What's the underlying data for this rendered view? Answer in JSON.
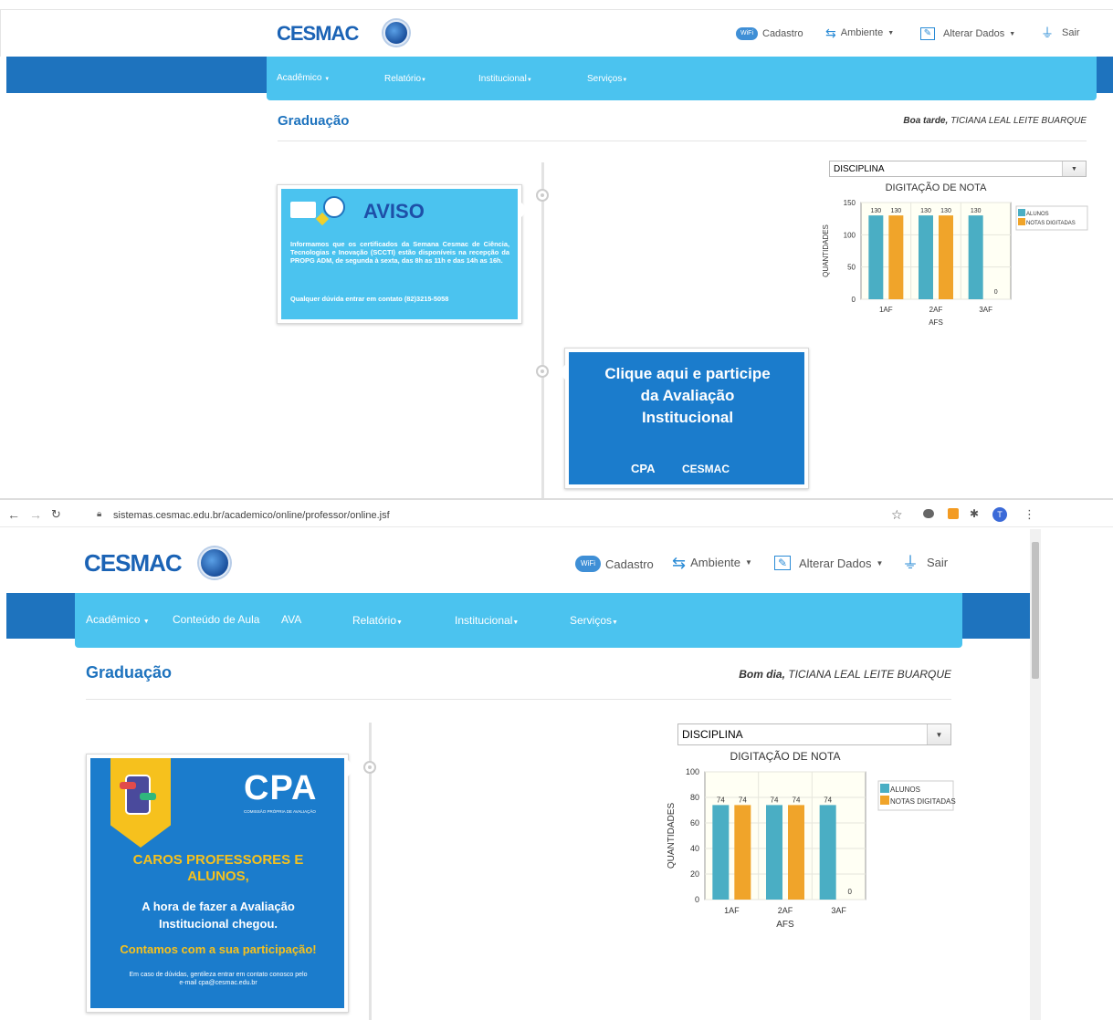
{
  "top": {
    "logo": "CESMAC",
    "nav": {
      "cadastro": "Cadastro",
      "ambiente": "Ambiente",
      "alterar": "Alterar Dados",
      "sair": "Sair",
      "wifi_text": "WiFi"
    },
    "menu": {
      "academico": "Acadêmico",
      "relatorio": "Relatório",
      "institucional": "Institucional",
      "servicos": "Serviços"
    },
    "page_title": "Graduação",
    "greeting_prefix": "Boa tarde,",
    "greeting_name": "TICIANA LEAL LEITE BUARQUE",
    "aviso": {
      "heading": "AVISO",
      "body": "Informamos que os certificados da Semana Cesmac de Ciência, Tecnologias e Inovação (SCCTI) estão disponíveis na recepção da PROPG ADM, de segunda à sexta, das 8h as 11h e das 14h as 16h.",
      "contact": "Qualquer dúvida entrar em contato (82)3215-5058"
    },
    "avaliacao": {
      "text": "Clique aqui e participe da Avaliação Institucional",
      "logo1": "CPA",
      "logo2": "CESMAC"
    },
    "select_value": "DISCIPLINA"
  },
  "browser": {
    "url": "sistemas.cesmac.edu.br/academico/online/professor/online.jsf",
    "profile_initial": "T"
  },
  "bottom": {
    "logo": "CESMAC",
    "nav": {
      "cadastro": "Cadastro",
      "ambiente": "Ambiente",
      "alterar": "Alterar Dados",
      "sair": "Sair",
      "wifi_text": "WiFi"
    },
    "menu": {
      "academico": "Acadêmico",
      "conteudo": "Conteúdo de Aula",
      "ava": "AVA",
      "relatorio": "Relatório",
      "institucional": "Institucional",
      "servicos": "Serviços"
    },
    "page_title": "Graduação",
    "greeting_prefix": "Bom dia,",
    "greeting_name": "TICIANA LEAL LEITE BUARQUE",
    "cpa_card": {
      "logo": "CPA",
      "logo_sub": "COMISSÃO PRÓPRIA DE AVALIAÇÃO",
      "heading": "CAROS PROFESSORES E ALUNOS,",
      "line1": "A hora de fazer a Avaliação Institucional chegou.",
      "line2": "Contamos com a sua participação!",
      "footer": "Em caso de dúvidas, gentileza entrar em contato conosco pelo e-mail cpa@cesmac.edu.br"
    },
    "select_value": "DISCIPLINA"
  },
  "chart_data": [
    {
      "type": "bar",
      "title": "DIGITAÇÃO DE NOTA",
      "xlabel": "AFS",
      "ylabel": "QUANTIDADES",
      "categories": [
        "1AF",
        "2AF",
        "3AF"
      ],
      "ylim": [
        0,
        150
      ],
      "yticks": [
        0,
        50,
        100,
        150
      ],
      "series": [
        {
          "name": "ALUNOS",
          "values": [
            130,
            130,
            130
          ],
          "color": "#4aaec4"
        },
        {
          "name": "NOTAS DIGITADAS",
          "values": [
            130,
            130,
            0
          ],
          "color": "#f0a42a"
        }
      ],
      "grid": true,
      "legend": "right"
    },
    {
      "type": "bar",
      "title": "DIGITAÇÃO DE NOTA",
      "xlabel": "AFS",
      "ylabel": "QUANTIDADES",
      "categories": [
        "1AF",
        "2AF",
        "3AF"
      ],
      "ylim": [
        0,
        100
      ],
      "yticks": [
        0,
        20,
        40,
        60,
        80,
        100
      ],
      "series": [
        {
          "name": "ALUNOS",
          "values": [
            74,
            74,
            74
          ],
          "color": "#4aaec4"
        },
        {
          "name": "NOTAS DIGITADAS",
          "values": [
            74,
            74,
            0
          ],
          "color": "#f0a42a"
        }
      ],
      "grid": true,
      "legend": "right"
    }
  ]
}
